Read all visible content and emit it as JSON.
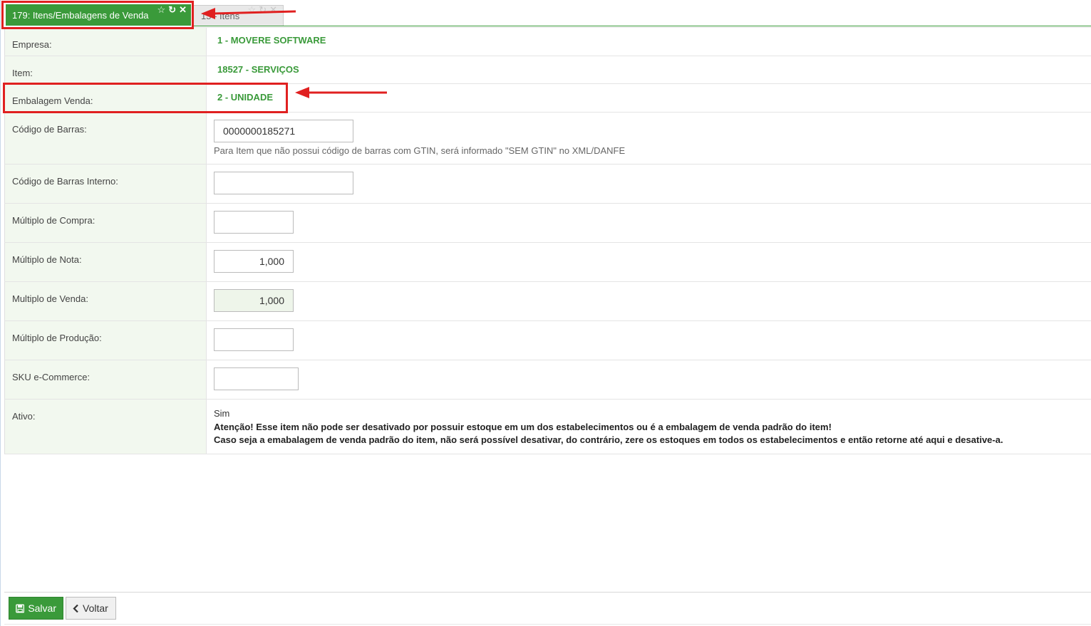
{
  "tabs": {
    "active_label": "179: Itens/Embalagens de Venda",
    "inactive_label": "15 - Itens"
  },
  "form": {
    "empresa": {
      "label": "Empresa:",
      "value": "1 - MOVERE SOFTWARE"
    },
    "item": {
      "label": "Item:",
      "value": "18527 - SERVIÇOS"
    },
    "embalagem": {
      "label": "Embalagem Venda:",
      "value": "2 - UNIDADE"
    },
    "codigo_barras": {
      "label": "Código de Barras:",
      "value": "0000000185271",
      "hint": "Para Item que não possui código de barras com GTIN, será informado \"SEM GTIN\" no XML/DANFE"
    },
    "codigo_barras_interno": {
      "label": "Código de Barras Interno:",
      "value": ""
    },
    "multiplo_compra": {
      "label": "Múltiplo de Compra:",
      "value": ""
    },
    "multiplo_nota": {
      "label": "Múltiplo de Nota:",
      "value": "1,000"
    },
    "multiplo_venda": {
      "label": "Multiplo de Venda:",
      "value": "1,000"
    },
    "multiplo_producao": {
      "label": "Múltiplo de Produção:",
      "value": ""
    },
    "sku": {
      "label": "SKU e-Commerce:",
      "value": ""
    },
    "ativo": {
      "label": "Ativo:",
      "value": "Sim",
      "warning_line1": "Atenção! Esse item não pode ser desativado por possuir estoque em um dos estabelecimentos ou é a embalagem de venda padrão do item!",
      "warning_line2": "Caso seja a emabalagem de venda padrão do item, não será possível desativar, do contrário, zere os estoques em todos os estabelecimentos e então retorne até aqui e desative-a."
    }
  },
  "footer": {
    "save_label": "Salvar",
    "back_label": "Voltar"
  },
  "colors": {
    "accent": "#3a9a3a",
    "annotation": "#e02020"
  },
  "icons": [
    "star-icon",
    "refresh-icon",
    "close-icon",
    "save-icon",
    "chevron-left-icon"
  ]
}
